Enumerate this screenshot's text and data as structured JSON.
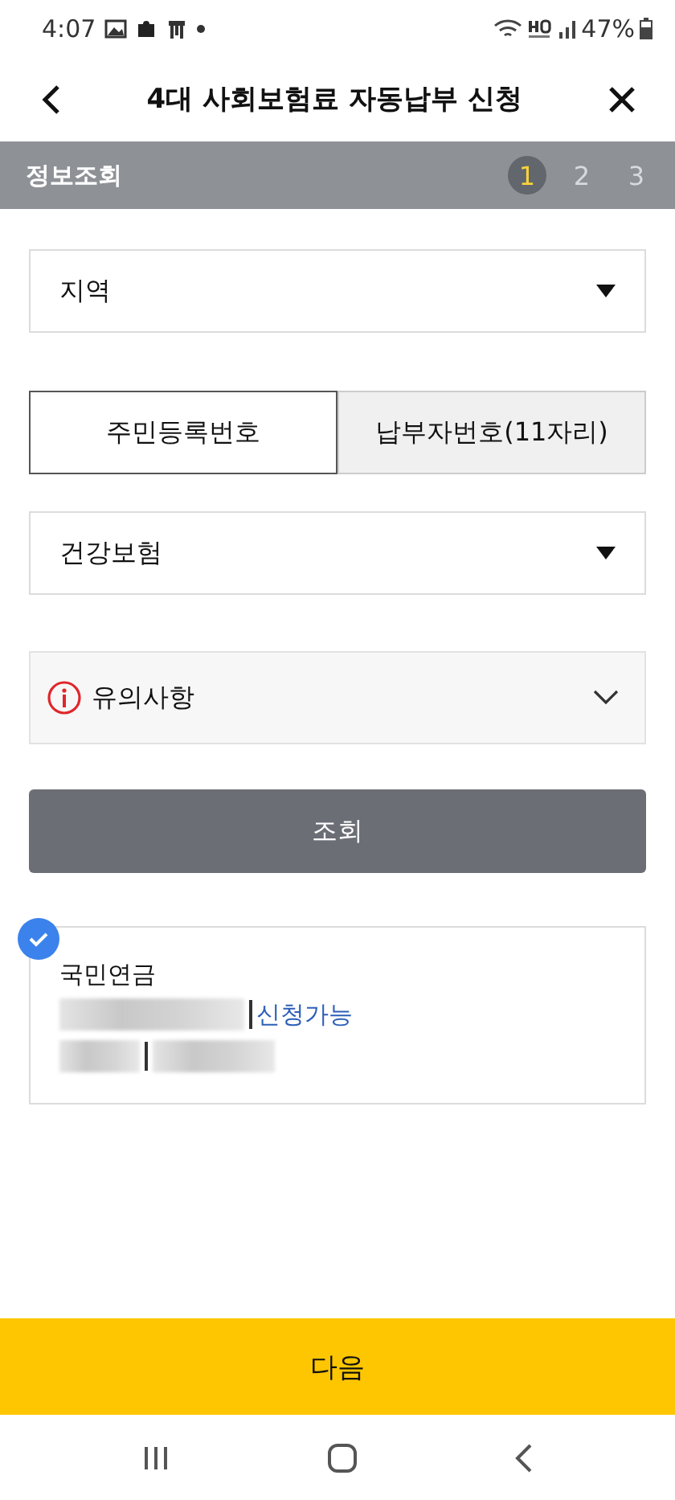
{
  "status_bar": {
    "time": "4:07",
    "battery": "47%"
  },
  "header": {
    "title": "4대 사회보험료 자동납부 신청"
  },
  "step_bar": {
    "label": "정보조회",
    "steps": [
      {
        "number": "1",
        "selected": true
      },
      {
        "number": "2",
        "selected": false
      },
      {
        "number": "3",
        "selected": false
      }
    ]
  },
  "region_select": {
    "value": "지역"
  },
  "id_tabs": [
    {
      "label": "주민등록번호",
      "selected": true
    },
    {
      "label": "납부자번호(11자리)",
      "selected": false
    }
  ],
  "insurance_select": {
    "value": "건강보험"
  },
  "notice": {
    "label": "유의사항",
    "expanded": false
  },
  "search_button": "조회",
  "result_card": {
    "checked": true,
    "title": "국민연금",
    "status": "신청가능"
  },
  "next_button": "다음"
}
